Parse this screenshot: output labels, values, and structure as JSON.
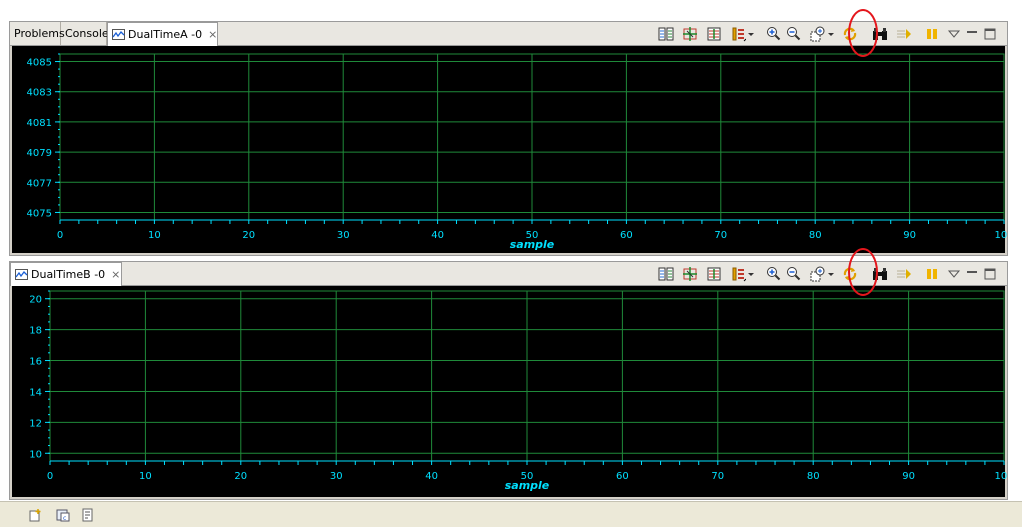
{
  "viewA": {
    "tabs": [
      {
        "label": "Problems"
      },
      {
        "label": "Console"
      },
      {
        "label": "DualTimeA -0"
      }
    ],
    "close_symbol": "⨯"
  },
  "viewB": {
    "tabs": [
      {
        "label": "DualTimeB -0"
      }
    ],
    "close_symbol": "⨯"
  },
  "toolbar_icons": [
    "show-all-icon",
    "zoom-fit-icon",
    "scale-icon",
    "settings-icon",
    "zoom-in-icon",
    "zoom-out-icon",
    "zoom-area-icon",
    "refresh-icon",
    "binoculars-icon",
    "step-icon",
    "pause-icon",
    "view-menu-icon",
    "minimize-icon",
    "maximize-icon"
  ],
  "statusbar_icons": [
    "new-view-icon",
    "memory-icon",
    "trace-icon"
  ],
  "colors": {
    "plot_bg": "#000000",
    "grid": "#1f8a3a",
    "axis_text": "#00e0ff",
    "highlight": "#e4161c"
  },
  "chart_data": [
    {
      "type": "line",
      "title": "DualTimeA -0",
      "xlabel": "sample",
      "ylabel": "",
      "xlim": [
        0,
        100
      ],
      "ylim": [
        4074.5,
        4085.5
      ],
      "x_ticks": [
        "0",
        "10",
        "20",
        "30",
        "40",
        "50",
        "60",
        "70",
        "80",
        "90",
        "100"
      ],
      "y_ticks": [
        "4085",
        "4083",
        "4081",
        "4079",
        "4077",
        "4075"
      ],
      "series": [],
      "grid": true,
      "legend": "none"
    },
    {
      "type": "line",
      "title": "DualTimeB -0",
      "xlabel": "sample",
      "ylabel": "",
      "xlim": [
        0,
        100
      ],
      "ylim": [
        9.5,
        20.5
      ],
      "x_ticks": [
        "0",
        "10",
        "20",
        "30",
        "40",
        "50",
        "60",
        "70",
        "80",
        "90",
        "100"
      ],
      "y_ticks": [
        "20",
        "18",
        "16",
        "14",
        "12",
        "10"
      ],
      "series": [],
      "grid": true,
      "legend": "none"
    }
  ]
}
